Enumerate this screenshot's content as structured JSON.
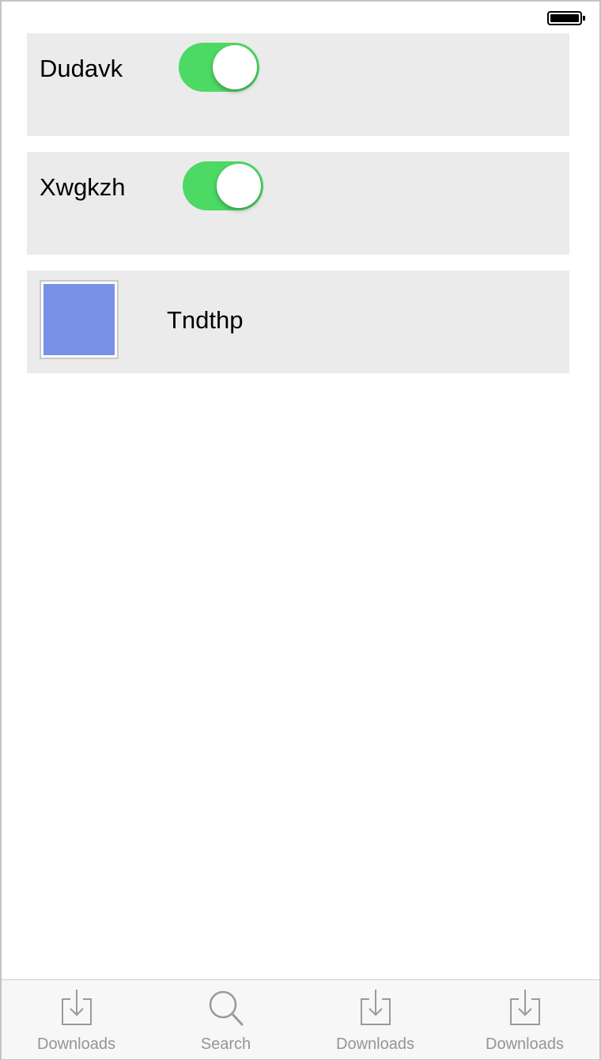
{
  "status_bar": {
    "battery_icon": "battery-full-icon"
  },
  "rows": [
    {
      "type": "toggle",
      "label": "Dudavk",
      "on": true
    },
    {
      "type": "toggle",
      "label": "Xwgkzh",
      "on": true
    },
    {
      "type": "image",
      "label": "Tndthp",
      "image_color": "#7890e6"
    }
  ],
  "colors": {
    "toggle_on": "#4cd964",
    "row_background": "#ebebeb",
    "tab_label": "#959595"
  },
  "tab_bar": {
    "tabs": [
      {
        "label": "Downloads",
        "icon": "downloads-icon"
      },
      {
        "label": "Search",
        "icon": "search-icon"
      },
      {
        "label": "Downloads",
        "icon": "downloads-icon"
      },
      {
        "label": "Downloads",
        "icon": "downloads-icon"
      }
    ]
  }
}
